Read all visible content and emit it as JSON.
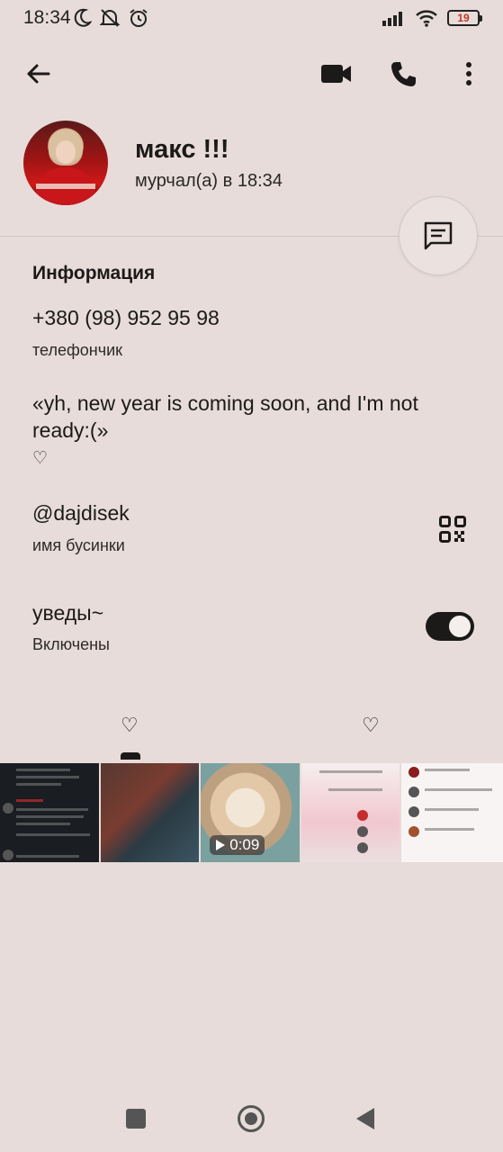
{
  "status_bar": {
    "time": "18:34",
    "battery": "19",
    "icons_left": [
      "moon-icon",
      "bell-off-icon",
      "alarm-icon"
    ],
    "icons_right": [
      "signal-icon",
      "wifi-icon",
      "battery-icon"
    ]
  },
  "app_bar": {
    "actions": [
      "back-arrow-icon",
      "video-call-icon",
      "phone-icon",
      "more-vert-icon"
    ]
  },
  "profile": {
    "name": "макс !!!",
    "status": "мурчал(а) в 18:34"
  },
  "info": {
    "title": "Информация",
    "phone": "+380 (98) 952 95 98",
    "phone_label": "телефончик",
    "bio": "«yh, new year is coming soon, and I'm not ready:(»",
    "bio_label": "♡",
    "username": "@dajdisek",
    "username_label": "имя бусинки",
    "notifications": "уведы~",
    "notifications_state": "Включены"
  },
  "tabs": [
    {
      "label": "♡",
      "selected": true
    },
    {
      "label": "♡",
      "selected": false
    }
  ],
  "media": {
    "video_duration": "0:09"
  },
  "colors": {
    "background": "#e7dcd9",
    "text": "#1c1a19",
    "toggle_on": "#1c1a19"
  }
}
